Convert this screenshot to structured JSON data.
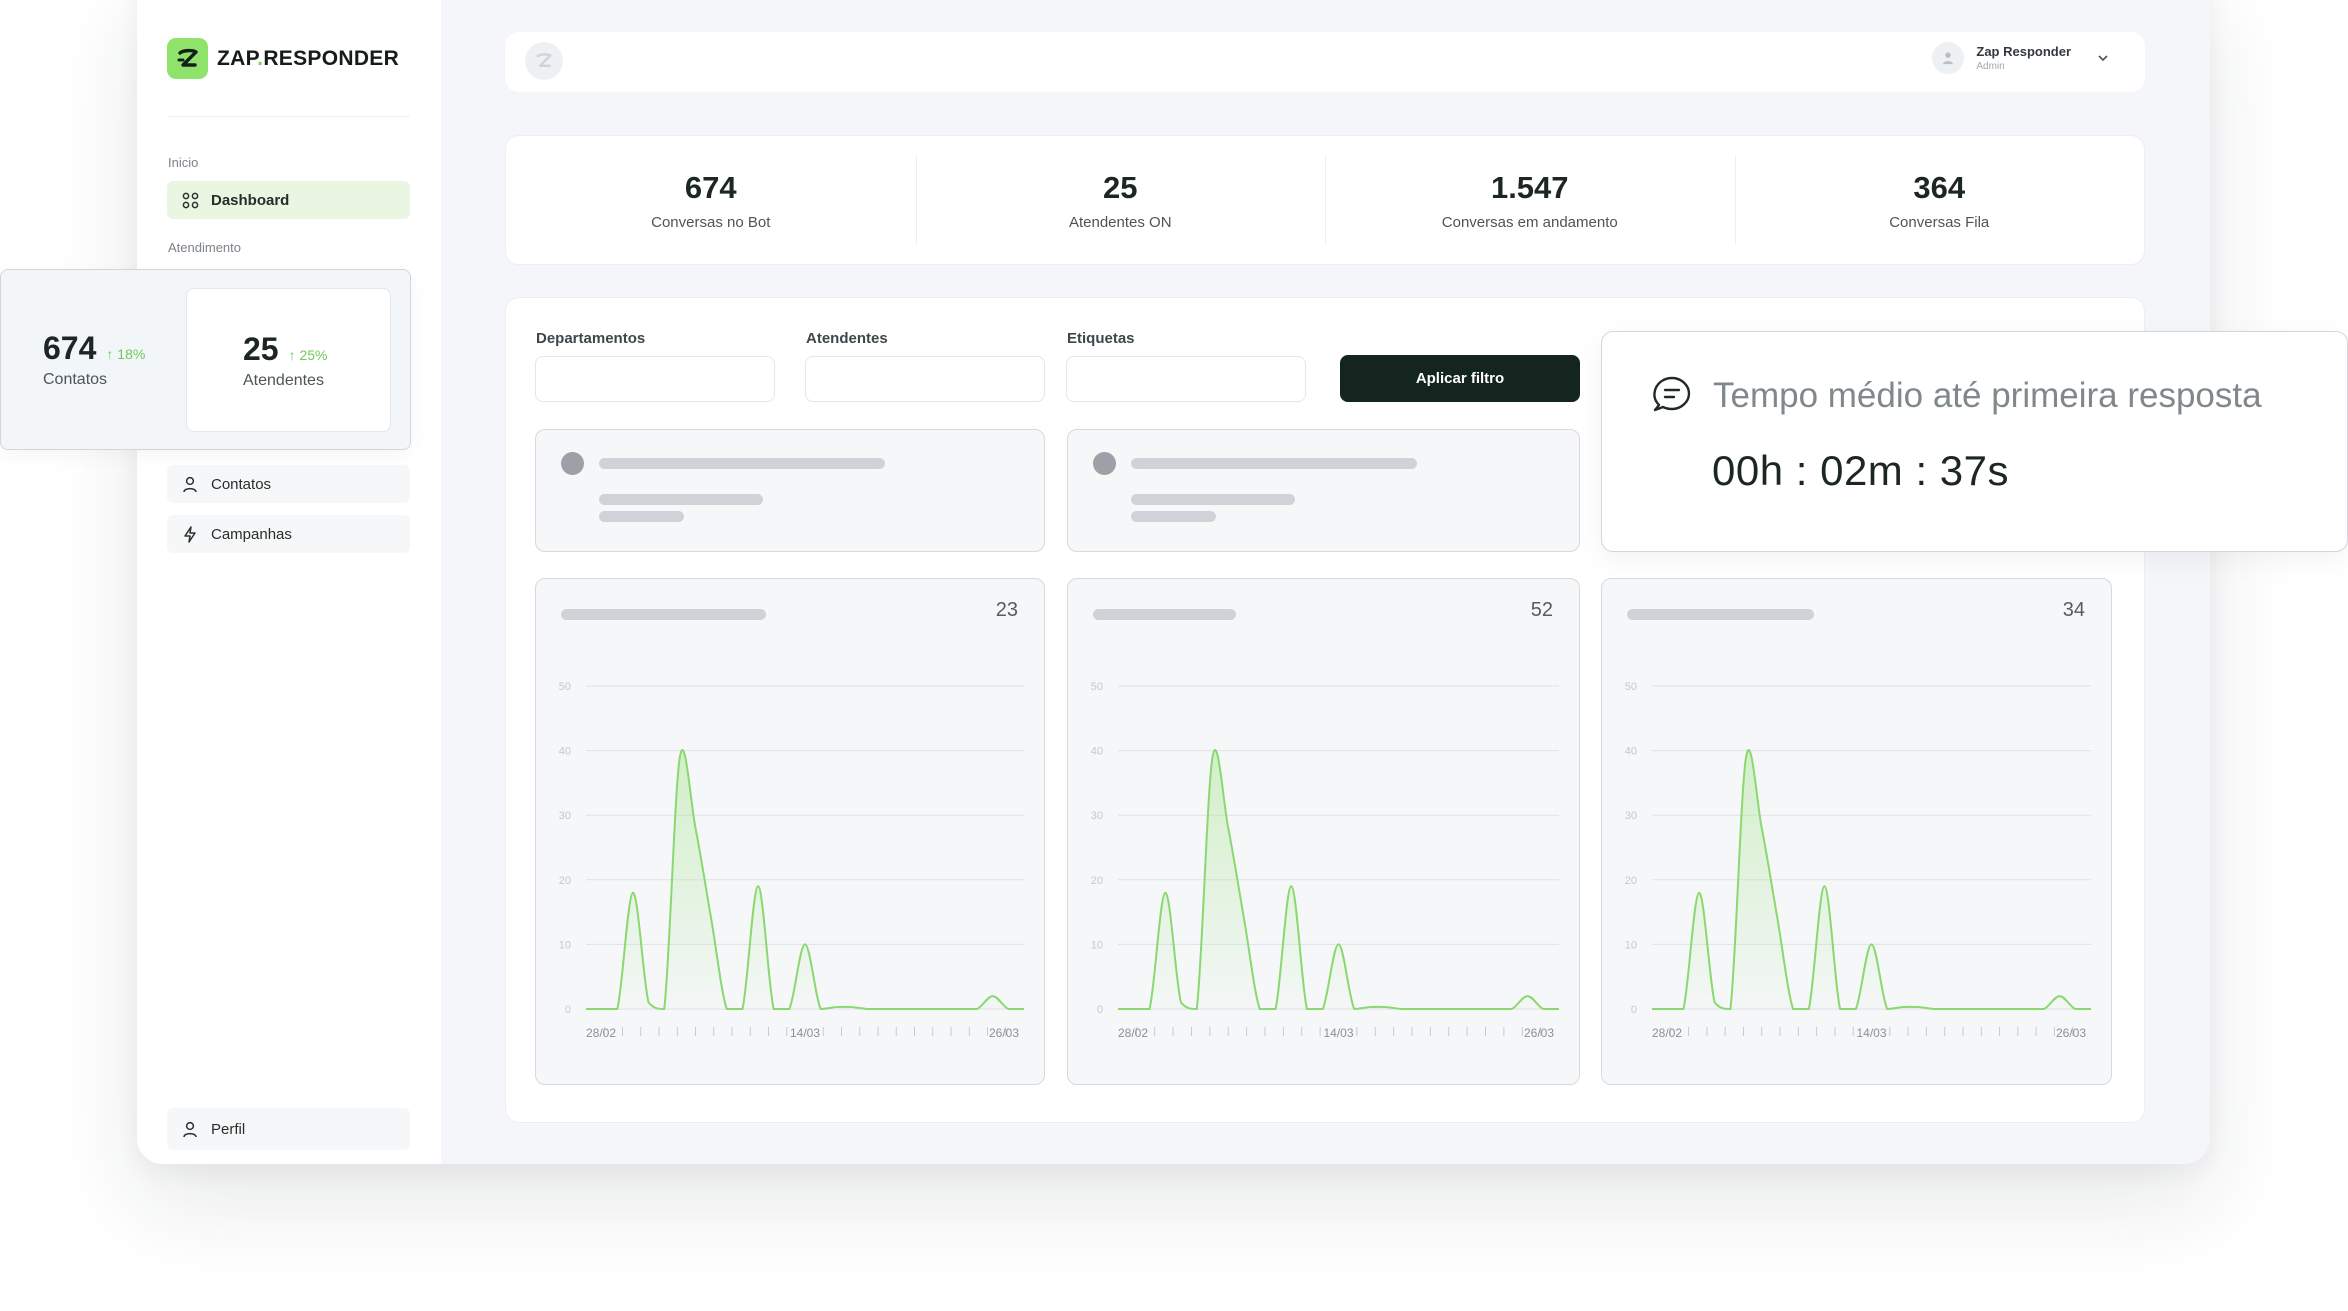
{
  "brand": {
    "name_part1": "ZAP",
    "name_dot": ".",
    "name_part2": "RESPONDER"
  },
  "sidebar": {
    "section_inicio": "Inicio",
    "section_atendimento": "Atendimento",
    "items": [
      {
        "label": "Dashboard",
        "icon": "grid-icon"
      },
      {
        "label": "Contatos",
        "icon": "user-icon"
      },
      {
        "label": "Campanhas",
        "icon": "bolt-icon"
      }
    ],
    "profile": {
      "label": "Perfil",
      "icon": "user-icon"
    }
  },
  "header": {
    "user_name": "Zap Responder",
    "user_role": "Admin"
  },
  "stats": [
    {
      "value": "674",
      "label": "Conversas no Bot"
    },
    {
      "value": "25",
      "label": "Atendentes ON"
    },
    {
      "value": "1.547",
      "label": "Conversas em andamento"
    },
    {
      "value": "364",
      "label": "Conversas Fila"
    }
  ],
  "filters": {
    "departamentos_label": "Departamentos",
    "atendentes_label": "Atendentes",
    "etiquetas_label": "Etiquetas",
    "apply_label": "Aplicar filtro"
  },
  "floating_stats": {
    "contatos": {
      "value": "674",
      "delta": "18%",
      "label": "Contatos"
    },
    "atendentes": {
      "value": "25",
      "delta": "25%",
      "label": "Atendentes"
    }
  },
  "tempo_card": {
    "title": "Tempo médio até primeira resposta",
    "value": "00h : 02m : 37s"
  },
  "colors": {
    "accent": "#8fe36a",
    "line": "#8ad86f",
    "dark": "#14241e",
    "delta": "#6bcb54"
  },
  "chart_data": [
    {
      "type": "area",
      "total": "23",
      "ylim": [
        0,
        50
      ],
      "yticks": [
        0,
        10,
        20,
        30,
        40,
        50
      ],
      "xtick_labels": [
        "28/02",
        "14/03",
        "26/03"
      ],
      "x": [
        0,
        1,
        2,
        3,
        4,
        5,
        6,
        7,
        8,
        9,
        10,
        11,
        12,
        13,
        14,
        15,
        16,
        17,
        18,
        19,
        20,
        21,
        22,
        23,
        24,
        25,
        26,
        27,
        28
      ],
      "y": [
        0,
        0,
        0,
        18,
        1,
        0,
        39,
        28,
        14,
        0,
        0,
        19,
        0,
        0,
        10,
        0,
        0.3,
        0.3,
        0,
        0,
        0,
        0,
        0,
        0,
        0,
        0,
        2,
        0,
        0
      ]
    },
    {
      "type": "area",
      "total": "52",
      "ylim": [
        0,
        50
      ],
      "yticks": [
        0,
        10,
        20,
        30,
        40,
        50
      ],
      "xtick_labels": [
        "28/02",
        "14/03",
        "26/03"
      ],
      "x": [
        0,
        1,
        2,
        3,
        4,
        5,
        6,
        7,
        8,
        9,
        10,
        11,
        12,
        13,
        14,
        15,
        16,
        17,
        18,
        19,
        20,
        21,
        22,
        23,
        24,
        25,
        26,
        27,
        28
      ],
      "y": [
        0,
        0,
        0,
        18,
        1,
        0,
        39,
        28,
        14,
        0,
        0,
        19,
        0,
        0,
        10,
        0,
        0.3,
        0.3,
        0,
        0,
        0,
        0,
        0,
        0,
        0,
        0,
        2,
        0,
        0
      ]
    },
    {
      "type": "area",
      "total": "34",
      "ylim": [
        0,
        50
      ],
      "yticks": [
        0,
        10,
        20,
        30,
        40,
        50
      ],
      "xtick_labels": [
        "28/02",
        "14/03",
        "26/03"
      ],
      "x": [
        0,
        1,
        2,
        3,
        4,
        5,
        6,
        7,
        8,
        9,
        10,
        11,
        12,
        13,
        14,
        15,
        16,
        17,
        18,
        19,
        20,
        21,
        22,
        23,
        24,
        25,
        26,
        27,
        28
      ],
      "y": [
        0,
        0,
        0,
        18,
        1,
        0,
        39,
        28,
        14,
        0,
        0,
        19,
        0,
        0,
        10,
        0,
        0.3,
        0.3,
        0,
        0,
        0,
        0,
        0,
        0,
        0,
        0,
        2,
        0,
        0
      ]
    }
  ]
}
